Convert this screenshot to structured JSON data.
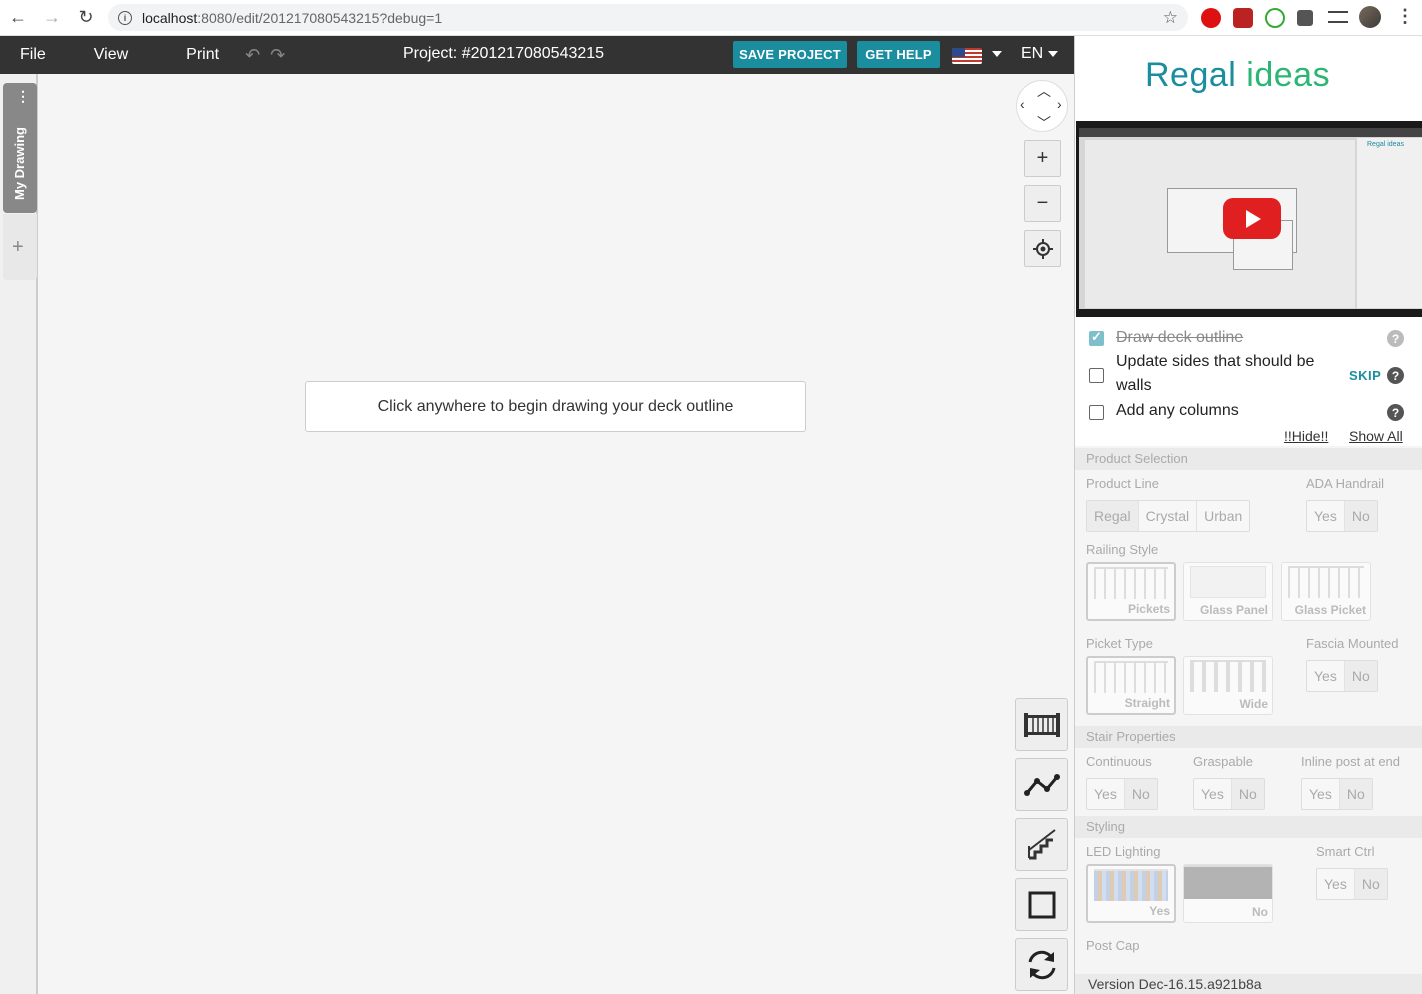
{
  "browser": {
    "url_host": "localhost",
    "url_path": ":8080/edit/201217080543215?debug=1"
  },
  "toolbar": {
    "menu": [
      "File",
      "View",
      "Print"
    ],
    "project_title": "Project: #201217080543215",
    "save_label": "SAVE PROJECT",
    "help_label": "GET HELP",
    "language": "EN"
  },
  "drawer": {
    "tab_label": "My Drawing",
    "add_label": "+"
  },
  "canvas": {
    "hint": "Click anywhere to begin drawing your deck outline",
    "zoom_in": "+",
    "zoom_out": "−"
  },
  "panel": {
    "logo_main": "Regal",
    "logo_accent": "ideas",
    "mini_logo": "Regal ideas",
    "tasks": [
      {
        "label": "Draw deck outline",
        "done": true
      },
      {
        "label": "Update sides that should be walls",
        "done": false
      },
      {
        "label": "Add any columns",
        "done": false
      }
    ],
    "skip_label": "SKIP",
    "hide_label": "!!Hide!!",
    "show_all_label": "Show All",
    "help_glyph": "?",
    "sections": {
      "product_selection": "Product Selection",
      "product_line": "Product Line",
      "product_line_options": [
        "Regal",
        "Crystal",
        "Urban"
      ],
      "ada_handrail": "ADA Handrail",
      "railing_style": "Railing Style",
      "railing_options": [
        "Pickets",
        "Glass Panel",
        "Glass Picket"
      ],
      "picket_type": "Picket Type",
      "picket_options": [
        "Straight",
        "Wide"
      ],
      "fascia_mounted": "Fascia Mounted",
      "stair_properties": "Stair Properties",
      "continuous": "Continuous",
      "graspable": "Graspable",
      "inline_post": "Inline post at end",
      "styling": "Styling",
      "led_lighting": "LED Lighting",
      "led_options": [
        "Yes",
        "No"
      ],
      "smart_ctrl": "Smart Ctrl",
      "post_cap": "Post Cap",
      "yes": "Yes",
      "no": "No"
    },
    "version": "Version  Dec-16.15.a921b8a"
  },
  "colors": {
    "accent": "#1a8d9f",
    "logo_green": "#2bb673",
    "toolbar_bg": "#333333"
  }
}
